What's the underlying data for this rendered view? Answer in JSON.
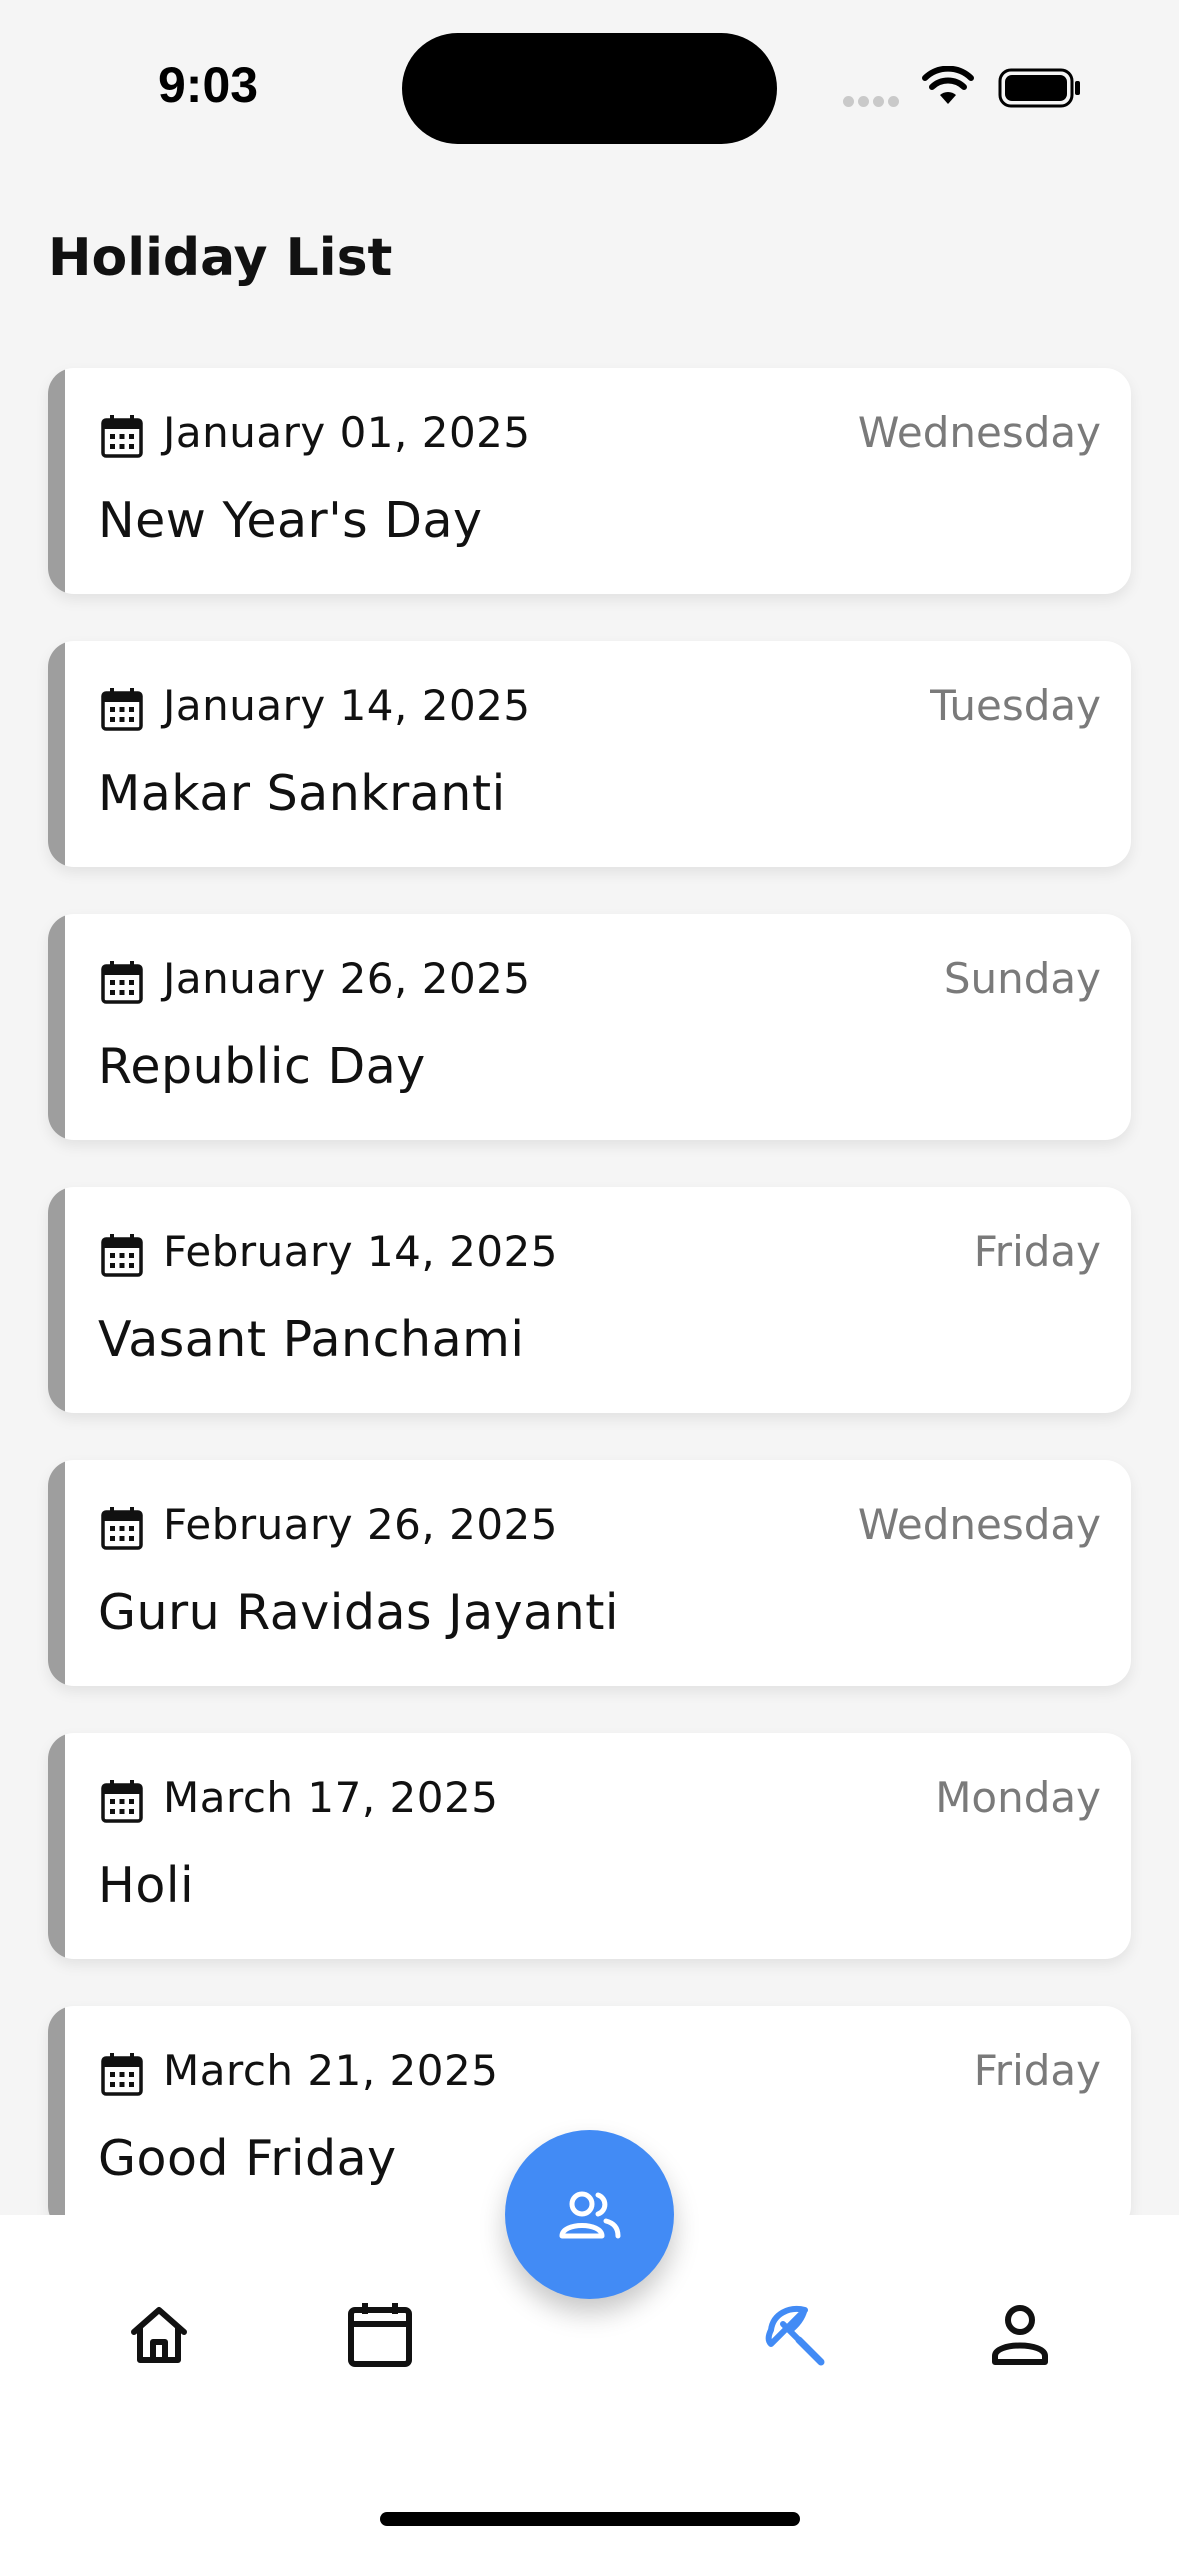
{
  "status_bar": {
    "time": "9:03"
  },
  "page": {
    "title": "Holiday List"
  },
  "holidays": [
    {
      "date": "January 01, 2025",
      "weekday": "Wednesday",
      "name": "New Year's Day"
    },
    {
      "date": "January 14, 2025",
      "weekday": "Tuesday",
      "name": "Makar Sankranti"
    },
    {
      "date": "January 26, 2025",
      "weekday": "Sunday",
      "name": "Republic Day"
    },
    {
      "date": "February 14, 2025",
      "weekday": "Friday",
      "name": "Vasant Panchami"
    },
    {
      "date": "February 26, 2025",
      "weekday": "Wednesday",
      "name": "Guru Ravidas Jayanti"
    },
    {
      "date": "March 17, 2025",
      "weekday": "Monday",
      "name": "Holi"
    },
    {
      "date": "March 21, 2025",
      "weekday": "Friday",
      "name": "Good Friday"
    }
  ],
  "bottom_nav": {
    "items": [
      {
        "icon": "home-icon",
        "active": false
      },
      {
        "icon": "calendar-icon",
        "active": false
      },
      {
        "icon": "team-icon",
        "active": false,
        "fab": true
      },
      {
        "icon": "umbrella-beach-icon",
        "active": true
      },
      {
        "icon": "profile-icon",
        "active": false
      }
    ]
  },
  "colors": {
    "accent": "#428bf5",
    "background": "#f5f5f5",
    "card_stripe": "#9e9e9e",
    "weekday_text": "#7a7a7a"
  }
}
